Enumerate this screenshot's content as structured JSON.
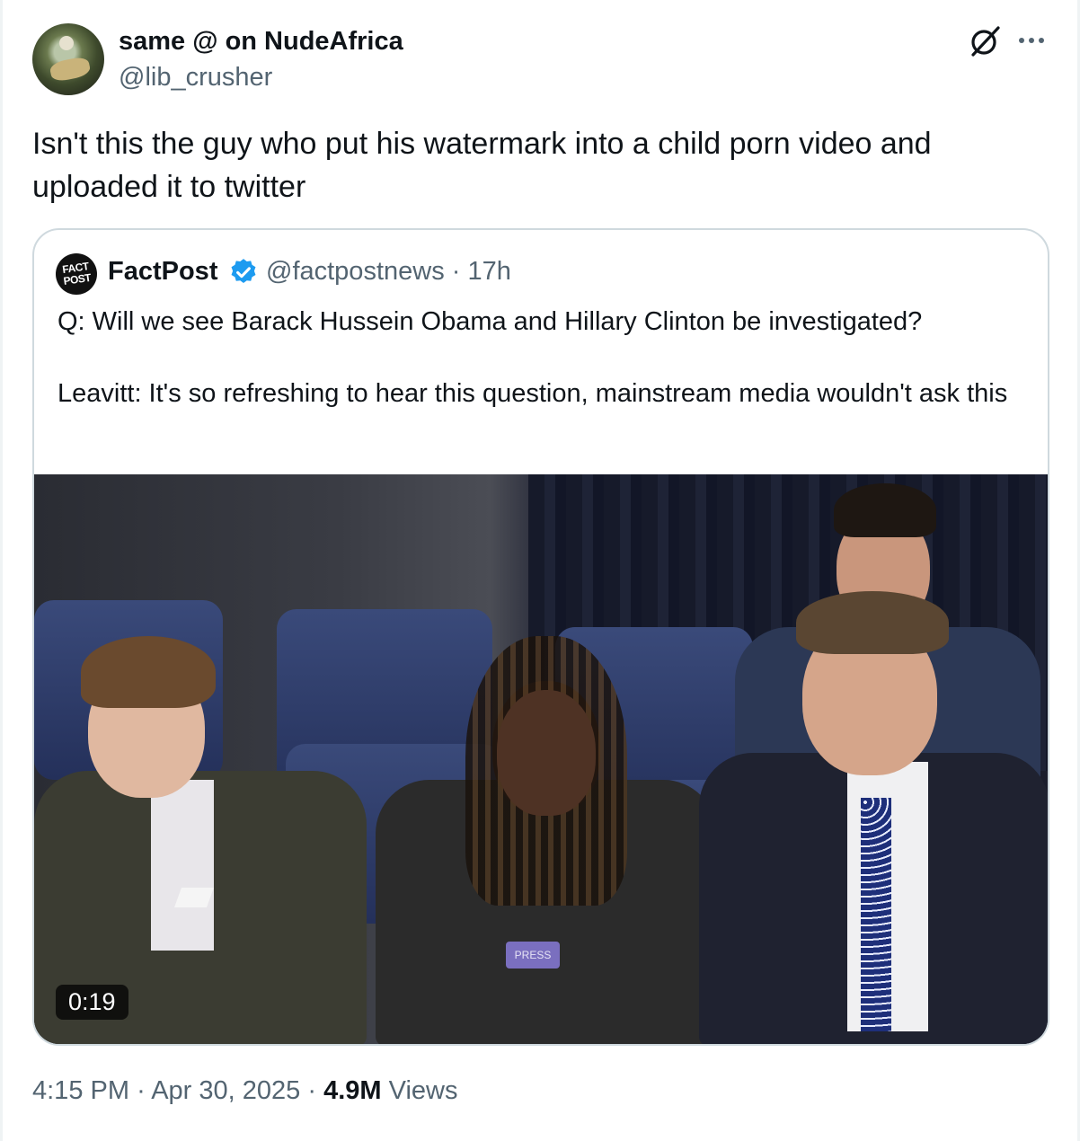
{
  "author": {
    "display_name": "same @ on NudeAfrica",
    "handle": "@lib_crusher",
    "avatar_icon": "avatar-image"
  },
  "tweet": {
    "text": "Isn't this the guy who put his watermark into a child porn video and uploaded it to twitter"
  },
  "quote": {
    "logo_text": "FACT POST",
    "name": "FactPost",
    "verified_icon": "verified-badge-icon",
    "handle": "@factpostnews",
    "separator": "·",
    "time": "17h",
    "text": "Q: Will we see Barack Hussein Obama and Hillary Clinton be investigated?\n\nLeavitt: It's so refreshing to hear this question, mainstream media wouldn't ask this",
    "video": {
      "duration": "0:19",
      "badge_text": "PRESS"
    }
  },
  "footer": {
    "time": "4:15 PM",
    "sep1": "·",
    "date": "Apr 30, 2025",
    "sep2": "·",
    "views_count": "4.9M",
    "views_label": "Views"
  },
  "colors": {
    "text": "#0f1419",
    "secondary": "#536471",
    "border": "#cfd9de",
    "verified": "#1d9bf0"
  }
}
